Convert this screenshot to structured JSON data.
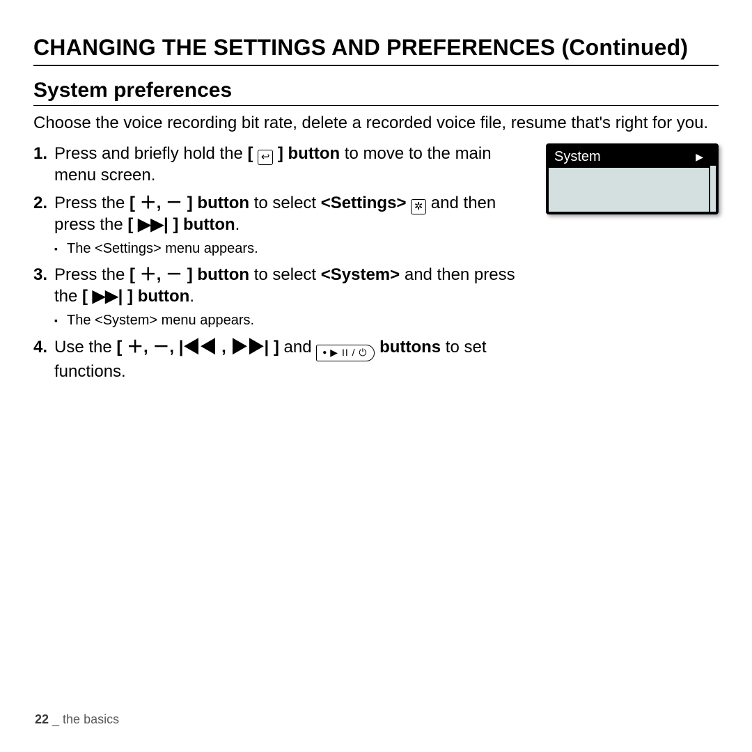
{
  "section_title": "CHANGING THE SETTINGS AND PREFERENCES (Continued)",
  "subsection_title": "System preferences",
  "intro": "Choose the voice recording bit rate, delete a recorded voice file, resume that's right for you.",
  "steps": {
    "s1a": "Press and briefly hold the ",
    "s1b": "button",
    "s1c": " to move to the main menu screen.",
    "s2a": "Press the ",
    "s2b": "button",
    "s2c": " to select ",
    "s2d": "<Settings>",
    "s2e": " and then press the ",
    "s2f": "button",
    "s2sub": "The <Settings> menu appears.",
    "s3a": "Press the ",
    "s3b": "button",
    "s3c": " to select ",
    "s3d": "<System>",
    "s3e": " and then press the ",
    "s3f": "button",
    "s3sub": "The <System> menu appears.",
    "s4a": "Use the ",
    "s4b": " and ",
    "s4c": "buttons",
    "s4d": " to set functions."
  },
  "symbols": {
    "back": "↩",
    "plusminus": "＋, －",
    "ff": "▶▶|",
    "nav4": "＋, －, |◀◀ , ▶▶|",
    "playpower": "▶ II / ⏻",
    "bracket_open": "[ ",
    "bracket_close": " ]"
  },
  "device": {
    "selected": "System",
    "arrow": "▶"
  },
  "footer": {
    "page": "22",
    "sep": " _ ",
    "label": "the basics"
  }
}
